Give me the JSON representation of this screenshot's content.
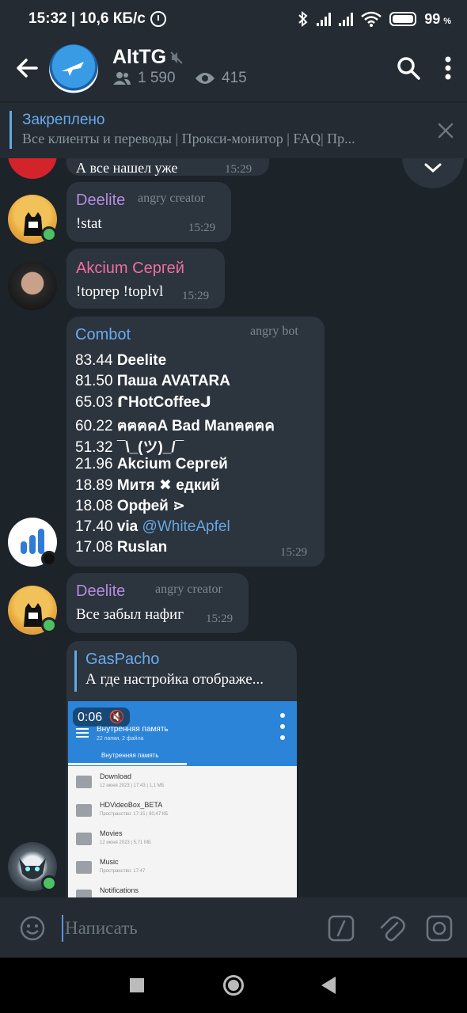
{
  "status": {
    "time": "15:32 | 10,6 КБ/с",
    "battery": "99",
    "battery_pct": "%"
  },
  "header": {
    "title": "AltTG",
    "members": "1 590",
    "views": "415"
  },
  "pinned": {
    "label": "Закреплено",
    "text": "Все клиенты и переводы | Прокси-монитор | FAQ| Пр..."
  },
  "chat": {
    "partial_top": {
      "text": "А все нашел уже",
      "time": "15:29"
    },
    "messages": [
      {
        "sender": "Deelite",
        "role": "angry creator",
        "text": "!stat",
        "time": "15:29",
        "sender_color": "#b58ce0"
      },
      {
        "sender": "Akcium Сергей",
        "text": "!toprep  !toplvl",
        "time": "15:29",
        "sender_color": "#f06ea0"
      },
      {
        "sender": "Combot",
        "role": "angry bot",
        "time": "15:29",
        "sender_color": "#6aaaf0",
        "leaderboard": [
          {
            "score": "83.44",
            "name": "Deelite"
          },
          {
            "score": "81.50",
            "name": "Паша AVATARA"
          },
          {
            "score": "65.03",
            "name": "ᒋHotCoffeeᒍ"
          },
          {
            "score": "60.22",
            "name": "ฅฅฅคA Bad Manฅฅฅค"
          },
          {
            "score": "51.32",
            "name": "¯\\_(ツ)_/¯"
          },
          {
            "score": "21.96",
            "name": "Akcium Сергей"
          },
          {
            "score": "18.89",
            "name": "Митя ✖ едкий"
          },
          {
            "score": "18.08",
            "name": "Орфей ⋗"
          },
          {
            "score": "17.40",
            "name_prefix": "via ",
            "name_link": "@WhiteApfel"
          },
          {
            "score": "17.08",
            "name": "Ruslan"
          }
        ]
      },
      {
        "sender": "Deelite",
        "role": "angry creator",
        "text": "Все забыл нафиг",
        "time": "15:29",
        "sender_color": "#b58ce0"
      },
      {
        "reply_sender": "GasPacho",
        "reply_text": "А где настройка отображе...",
        "video_time": "0:06",
        "video": {
          "title": "Внутренняя память",
          "subtitle": "22 папки, 2 файла",
          "tab": "Внутренняя память",
          "rows": [
            {
              "name": "Download",
              "sub": "12 июня 2023 | 17:43 | 1,1 МБ"
            },
            {
              "name": "HDVideoBox_BETA",
              "sub": "Пространство: 17:15 | 80,47 КБ"
            },
            {
              "name": "Movies",
              "sub": "12 июня 2023 | 5,71 МБ"
            },
            {
              "name": "Music",
              "sub": "Пространство: 17:47"
            },
            {
              "name": "Notifications",
              "sub": ""
            }
          ]
        }
      }
    ]
  },
  "input": {
    "placeholder": "Написать"
  }
}
